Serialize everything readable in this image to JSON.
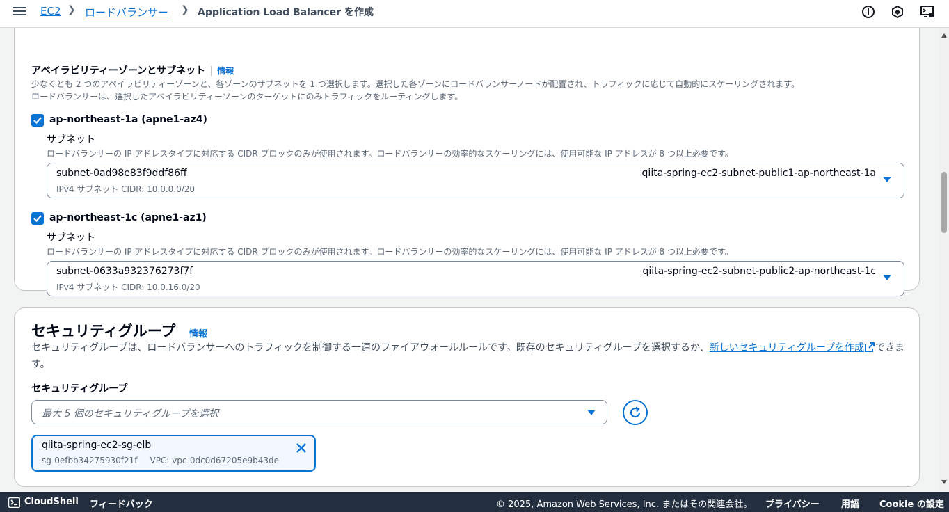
{
  "header": {
    "breadcrumb": {
      "ec2": "EC2",
      "load_balancers": "ロードバランサー",
      "current": "Application Load Balancer を作成"
    },
    "icons": [
      "info-circle-icon",
      "notifications-icon",
      "cloudshell-feedback-icon"
    ]
  },
  "az_section": {
    "title": "アベイラビリティーゾーンとサブネット",
    "info": "情報",
    "description_line1": "少なくとも 2 つのアベイラビリティーゾーンと、各ゾーンのサブネットを 1 つ選択します。選択した各ゾーンにロードバランサーノードが配置され、トラフィックに応じて自動的にスケーリングされます。",
    "description_line2": "ロードバランサーは、選択したアベイラビリティーゾーンのターゲットにのみトラフィックをルーティングします。",
    "zones": [
      {
        "label": "ap-northeast-1a (apne1-az4)",
        "checked": true,
        "subnet_label": "サブネット",
        "subnet_desc": "ロードバランサーの IP アドレスタイプに対応する CIDR ブロックのみが使用されます。ロードバランサーの効率的なスケーリングには、使用可能な IP アドレスが 8 つ以上必要です。",
        "subnet_id": "subnet-0ad98e83f9ddf86ff",
        "subnet_cidr": "IPv4 サブネット CIDR: 10.0.0.0/20",
        "subnet_name": "qiita-spring-ec2-subnet-public1-ap-northeast-1a"
      },
      {
        "label": "ap-northeast-1c (apne1-az1)",
        "checked": true,
        "subnet_label": "サブネット",
        "subnet_desc": "ロードバランサーの IP アドレスタイプに対応する CIDR ブロックのみが使用されます。ロードバランサーの効率的なスケーリングには、使用可能な IP アドレスが 8 つ以上必要です。",
        "subnet_id": "subnet-0633a932376273f7f",
        "subnet_cidr": "IPv4 サブネット CIDR: 10.0.16.0/20",
        "subnet_name": "qiita-spring-ec2-subnet-public2-ap-northeast-1c"
      }
    ]
  },
  "sg_section": {
    "title": "セキュリティグループ",
    "info": "情報",
    "description_part1": "セキュリティグループは、ロードバランサーへのトラフィックを制御する一連のファイアウォールルールです。既存のセキュリティグループを選択するか、",
    "description_link": "新しいセキュリティグループを作成",
    "description_part2": "できます。",
    "field_label": "セキュリティグループ",
    "placeholder": "最大 5 個のセキュリティグループを選択",
    "selected": {
      "name": "qiita-spring-ec2-sg-elb",
      "id": "sg-0efbb34275930f21f",
      "vpc": "VPC: vpc-0dc0d67205e9b43de"
    }
  },
  "footer": {
    "cloudshell": "CloudShell",
    "feedback": "フィードバック",
    "copyright": "© 2025, Amazon Web Services, Inc. またはその関連会社。",
    "privacy": "プライバシー",
    "terms": "用語",
    "cookie": "Cookie の設定"
  },
  "colors": {
    "accent": "#0972d3",
    "footer_bg": "#232f3e",
    "page_bg": "#f2f3f3"
  }
}
